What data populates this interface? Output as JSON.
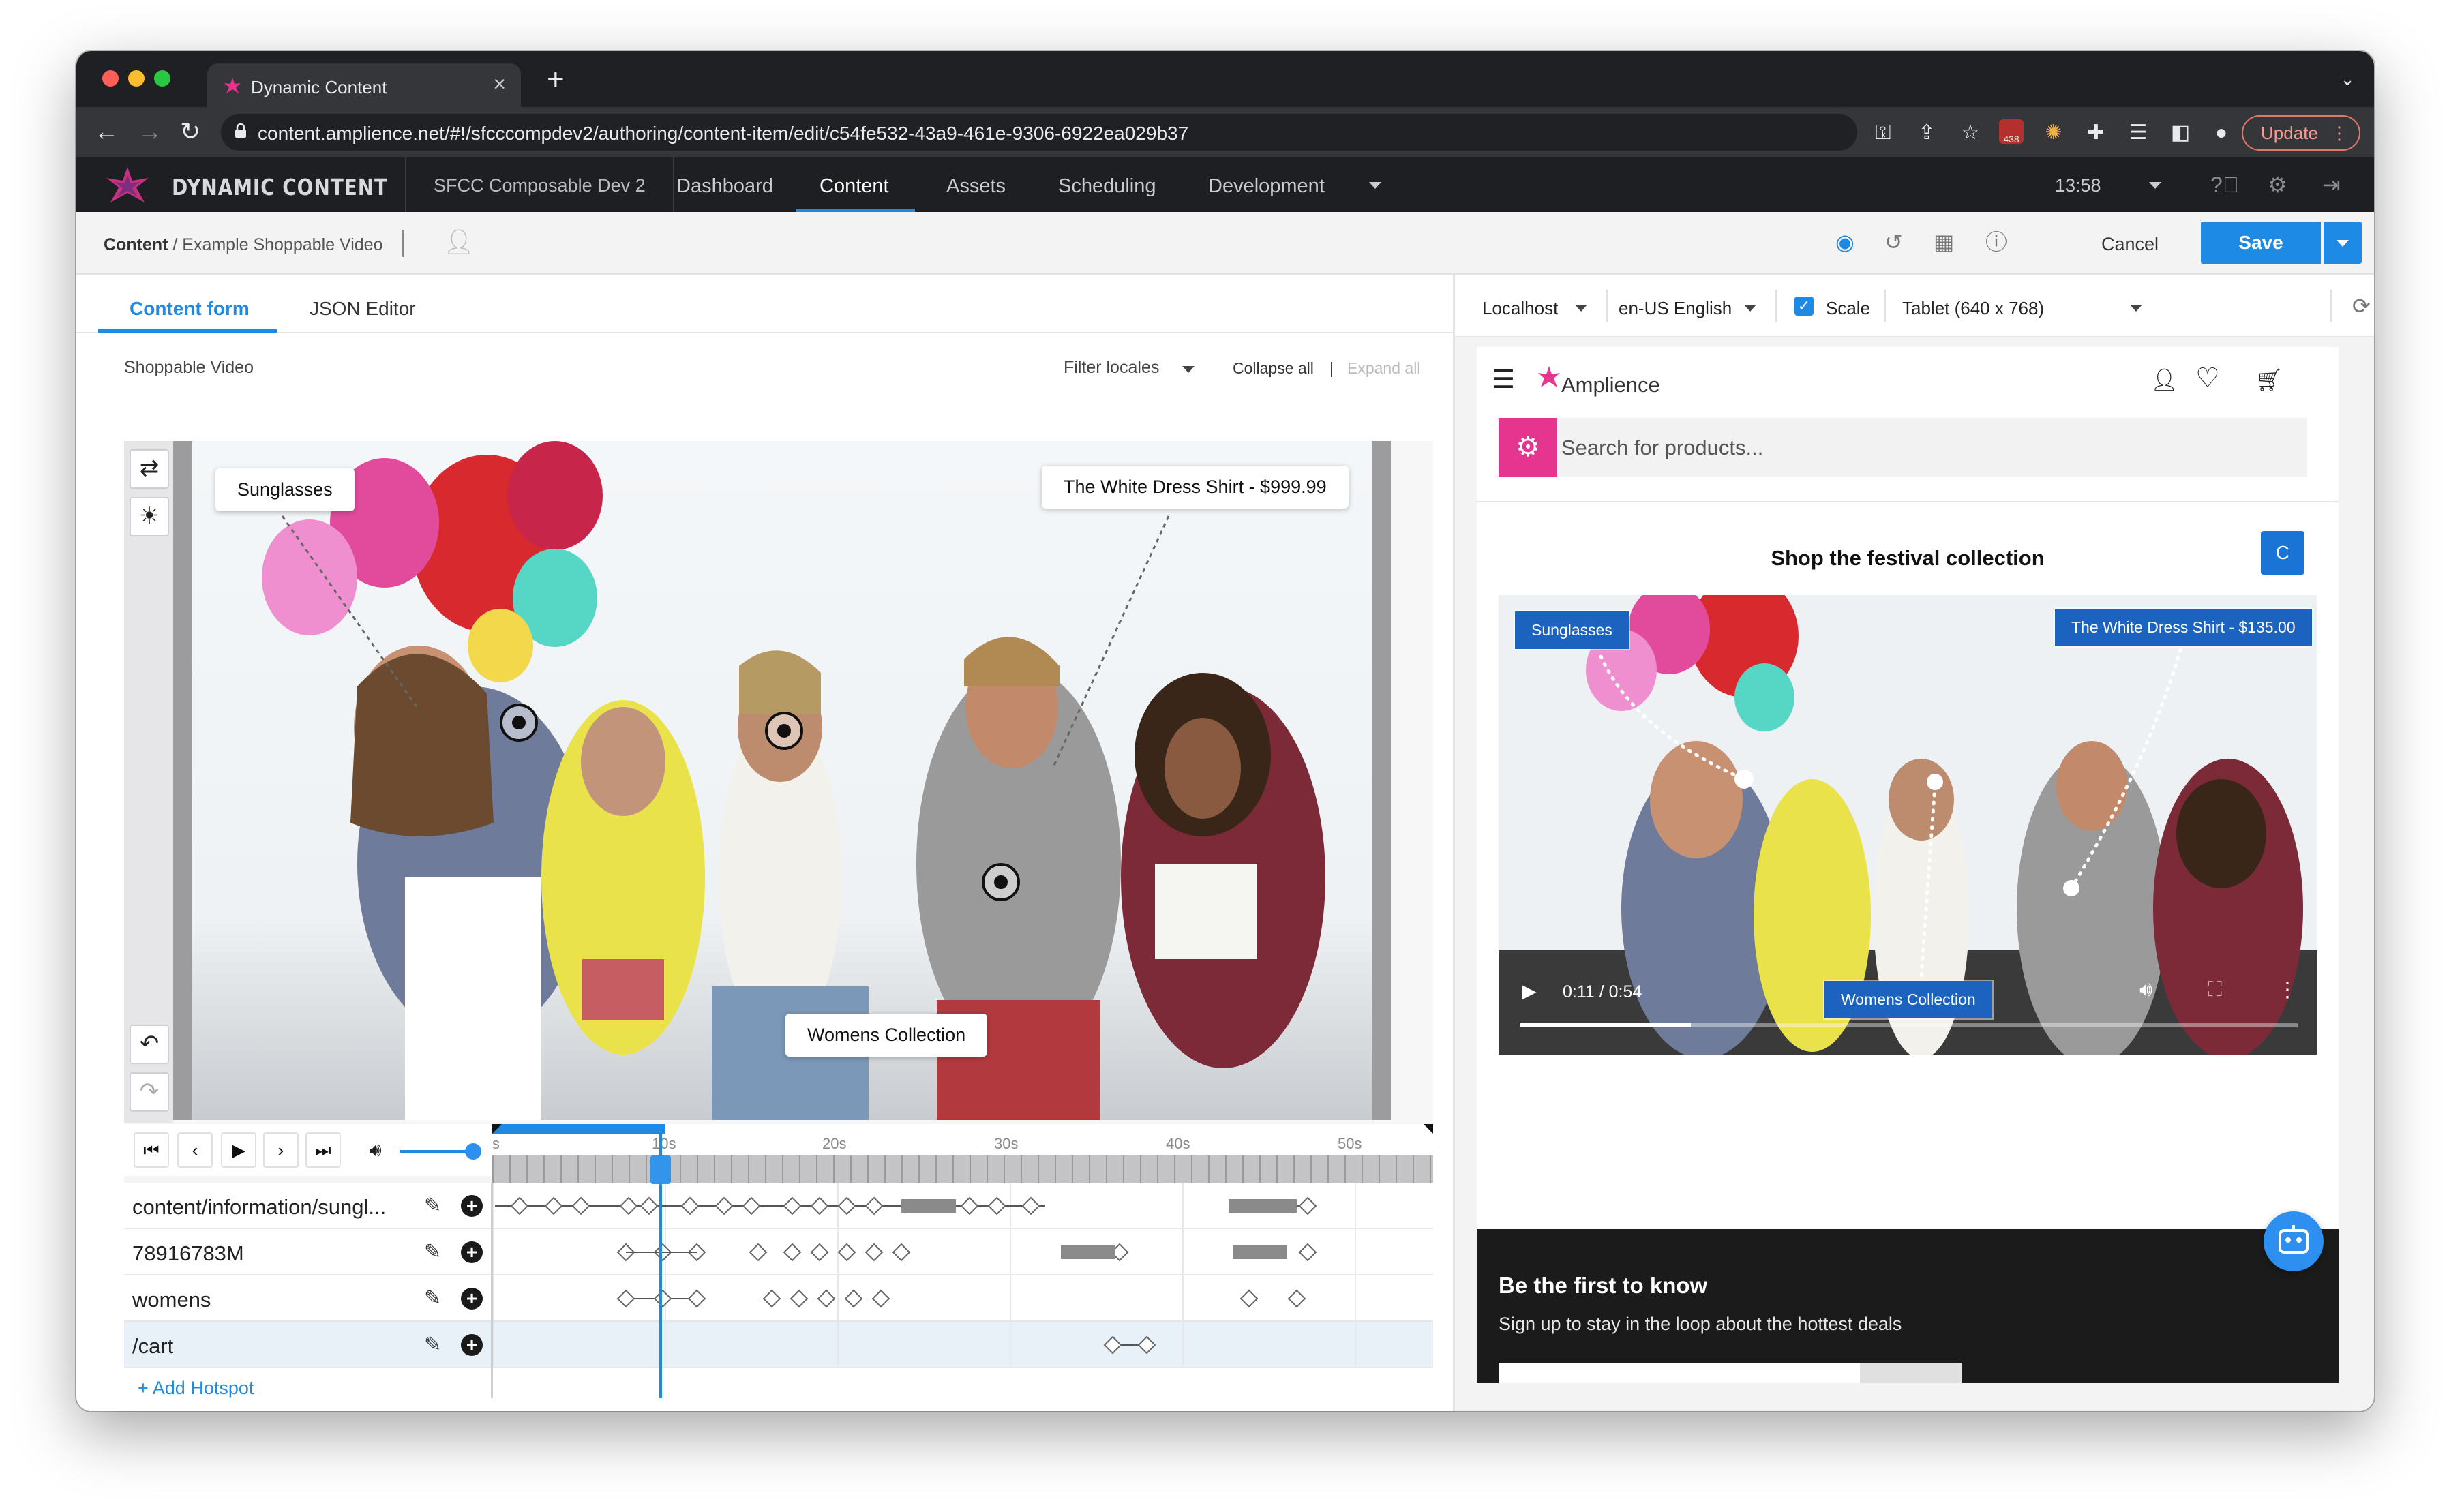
{
  "browser": {
    "tab_title": "Dynamic Content",
    "url": "content.amplience.net/#!/sfcccompdev2/authoring/content-item/edit/c54fe532-43a9-461e-9306-6922ea029b37",
    "badge_count": "438",
    "update_label": "Update"
  },
  "app": {
    "logo_text": "DYNAMIC CONTENT",
    "hub_name": "SFCC Composable Dev 2",
    "nav": [
      "Dashboard",
      "Content",
      "Assets",
      "Scheduling",
      "Development"
    ],
    "active_nav": "Content",
    "clock": "13:58"
  },
  "toolbar": {
    "breadcrumb_root": "Content",
    "breadcrumb_item": "/ Example Shoppable Video",
    "cancel_label": "Cancel",
    "save_label": "Save"
  },
  "form": {
    "tabs": [
      "Content form",
      "JSON Editor"
    ],
    "field_label": "Shoppable Video",
    "filter_locales": "Filter locales",
    "collapse_all": "Collapse all",
    "separator": "|",
    "expand_all": "Expand all"
  },
  "video_editor": {
    "labels": {
      "sunglasses": "Sunglasses",
      "shirt": "The White Dress Shirt - $999.99",
      "womens": "Womens Collection"
    },
    "ruler_labels": [
      "s",
      "10s",
      "20s",
      "30s",
      "40s",
      "50s"
    ],
    "tracks": [
      {
        "name": "content/information/sungl..."
      },
      {
        "name": "78916783M"
      },
      {
        "name": "womens"
      },
      {
        "name": "/cart"
      }
    ],
    "add_hotspot": "+ Add Hotspot"
  },
  "preview": {
    "locale_server": "Localhost",
    "locale_lang": "en-US English",
    "scale_label": "Scale",
    "device": "Tablet (640 x 768)",
    "brand": "Amplience",
    "search_placeholder": "Search for products...",
    "section_title": "Shop the festival collection",
    "c_badge": "C",
    "labels": {
      "sunglasses": "Sunglasses",
      "shirt": "The White Dress Shirt - $135.00",
      "womens": "Womens Collection"
    },
    "time": "0:11 / 0:54",
    "footer_title": "Be the first to know",
    "footer_sub": "Sign up to stay in the loop about the hottest deals"
  },
  "colors": {
    "accent": "#1d8ae5",
    "brand_pink": "#e5358f",
    "header_dark": "#1d1f23"
  }
}
